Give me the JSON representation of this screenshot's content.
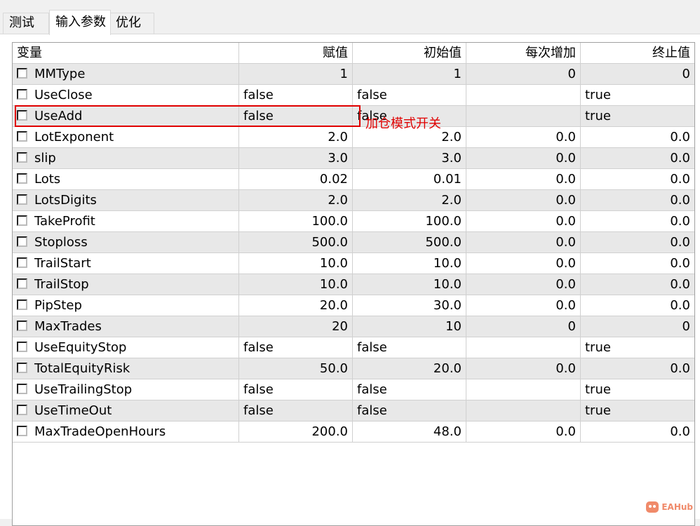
{
  "tabs": [
    {
      "label": "测试",
      "active": false
    },
    {
      "label": "输入参数",
      "active": true
    },
    {
      "label": "优化",
      "active": false
    }
  ],
  "table": {
    "columns": [
      "变量",
      "赋值",
      "初始值",
      "每次增加",
      "终止值"
    ],
    "rows": [
      {
        "name": "MMType",
        "value": "1",
        "start": "1",
        "step": "0",
        "stop": "0"
      },
      {
        "name": "UseClose",
        "value": "false",
        "start": "false",
        "step": "",
        "stop": "true"
      },
      {
        "name": "UseAdd",
        "value": "false",
        "start": "false",
        "step": "",
        "stop": "true"
      },
      {
        "name": "LotExponent",
        "value": "2.0",
        "start": "2.0",
        "step": "0.0",
        "stop": "0.0"
      },
      {
        "name": "slip",
        "value": "3.0",
        "start": "3.0",
        "step": "0.0",
        "stop": "0.0"
      },
      {
        "name": "Lots",
        "value": "0.02",
        "start": "0.01",
        "step": "0.0",
        "stop": "0.0"
      },
      {
        "name": "LotsDigits",
        "value": "2.0",
        "start": "2.0",
        "step": "0.0",
        "stop": "0.0"
      },
      {
        "name": "TakeProfit",
        "value": "100.0",
        "start": "100.0",
        "step": "0.0",
        "stop": "0.0"
      },
      {
        "name": "Stoploss",
        "value": "500.0",
        "start": "500.0",
        "step": "0.0",
        "stop": "0.0"
      },
      {
        "name": "TrailStart",
        "value": "10.0",
        "start": "10.0",
        "step": "0.0",
        "stop": "0.0"
      },
      {
        "name": "TrailStop",
        "value": "10.0",
        "start": "10.0",
        "step": "0.0",
        "stop": "0.0"
      },
      {
        "name": "PipStep",
        "value": "20.0",
        "start": "30.0",
        "step": "0.0",
        "stop": "0.0"
      },
      {
        "name": "MaxTrades",
        "value": "20",
        "start": "10",
        "step": "0",
        "stop": "0"
      },
      {
        "name": "UseEquityStop",
        "value": "false",
        "start": "false",
        "step": "",
        "stop": "true"
      },
      {
        "name": "TotalEquityRisk",
        "value": "50.0",
        "start": "20.0",
        "step": "0.0",
        "stop": "0.0"
      },
      {
        "name": "UseTrailingStop",
        "value": "false",
        "start": "false",
        "step": "",
        "stop": "true"
      },
      {
        "name": "UseTimeOut",
        "value": "false",
        "start": "false",
        "step": "",
        "stop": "true"
      },
      {
        "name": "MaxTradeOpenHours",
        "value": "200.0",
        "start": "48.0",
        "step": "0.0",
        "stop": "0.0"
      }
    ]
  },
  "annotation": {
    "text": "加仓模式开关",
    "color": "#e00000"
  },
  "watermark": {
    "text": "EAHub"
  }
}
